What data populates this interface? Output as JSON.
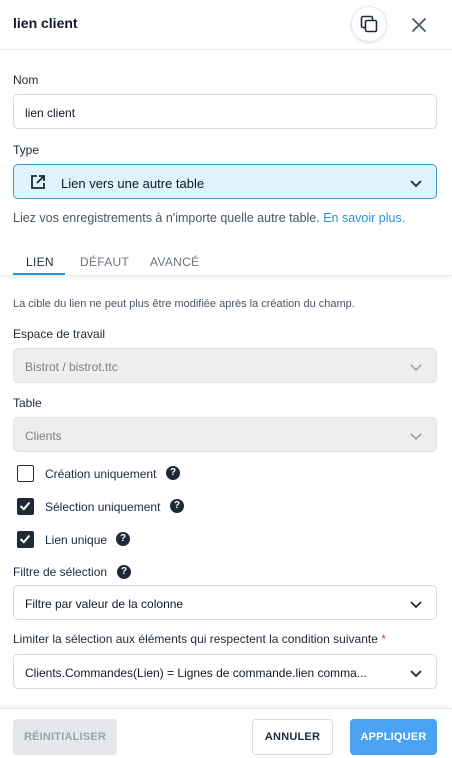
{
  "header": {
    "title": "lien client"
  },
  "name_field": {
    "label": "Nom",
    "value": "lien client"
  },
  "type_field": {
    "label": "Type",
    "value": "Lien vers une autre table",
    "icon": "external-link-icon"
  },
  "help": {
    "text": "Liez vos enregistrements à n'importe quelle autre table.",
    "link": "En savoir plus."
  },
  "tabs": [
    {
      "label": "LIEN",
      "active": true
    },
    {
      "label": "DÉFAUT",
      "active": false
    },
    {
      "label": "AVANCÉ",
      "active": false
    }
  ],
  "note": "La cible du lien ne peut plus être modifiée après la création du champ.",
  "workspace": {
    "label": "Espace de travail",
    "value": "Bistrot / bistrot.ttc"
  },
  "table": {
    "label": "Table",
    "value": "Clients"
  },
  "checkboxes": [
    {
      "label": "Création uniquement",
      "checked": false
    },
    {
      "label": "Sélection uniquement",
      "checked": true
    },
    {
      "label": "Lien unique",
      "checked": true
    }
  ],
  "filter": {
    "label": "Filtre de sélection",
    "value": "Filtre par valeur de la colonne"
  },
  "condition": {
    "label": "Limiter la sélection aux éléments qui respectent la condition suivante",
    "required_mark": "*",
    "value": "Clients.Commandes(Lien) = Lignes de commande.lien comma..."
  },
  "footer": {
    "reset_label": "RÉINITIALISER",
    "cancel_label": "ANNULER",
    "apply_label": "APPLIQUER"
  },
  "colors": {
    "accent": "#2f8fd6",
    "apply_button": "#4aa3f0",
    "type_field_bg": "#dff3fc"
  }
}
